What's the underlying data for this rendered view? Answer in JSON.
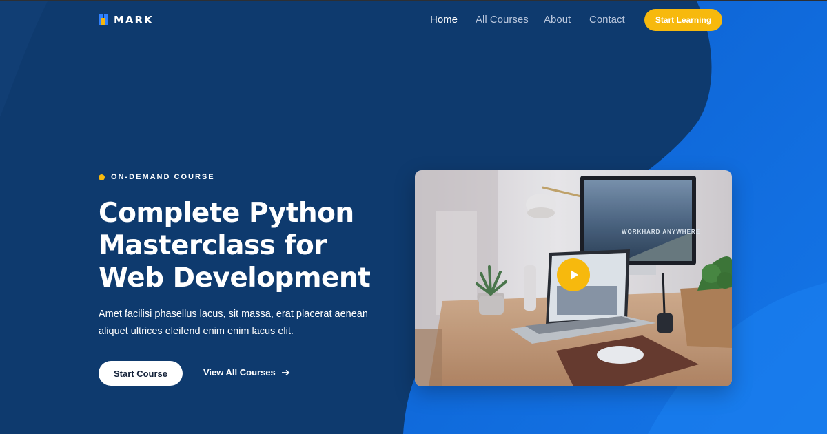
{
  "brand": {
    "name": "MARK"
  },
  "nav": {
    "items": [
      {
        "label": "Home",
        "active": true
      },
      {
        "label": "All Courses",
        "active": false
      },
      {
        "label": "About",
        "active": false
      },
      {
        "label": "Contact",
        "active": false
      }
    ],
    "cta_label": "Start Learning"
  },
  "hero": {
    "tagline": "ON-DEMAND COURSE",
    "title_lines": [
      "Complete Python",
      "Masterclass for",
      "Web Development"
    ],
    "description": "Amet facilisi phasellus lacus, sit massa, erat placerat aenean aliquet ultrices eleifend enim enim lacus elit.",
    "primary_button": "Start Course",
    "secondary_link": "View All Courses"
  },
  "media": {
    "screen_text": "WORKHARD ANYWHERE",
    "play_icon": "play-icon"
  },
  "colors": {
    "background": "#0e3a6e",
    "accent_blue": "#1a6fe0",
    "accent_yellow": "#f7b90d",
    "nav_inactive": "#b9c6dc"
  }
}
